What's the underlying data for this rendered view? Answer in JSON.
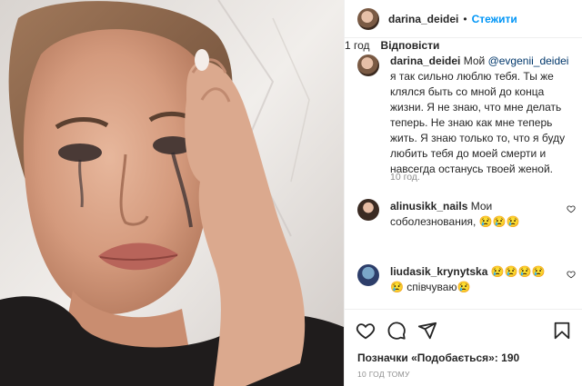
{
  "header": {
    "username": "darina_deidei",
    "separator": "•",
    "follow_label": "Стежити"
  },
  "caption": {
    "username": "darina_deidei",
    "text_before": "Мой ",
    "mention": "@evgenii_deidei",
    "text_after": " я так сильно люблю тебя. Ты же клялся быть со мной до конца жизни. Я не знаю, что мне делать теперь. Не знаю как мне теперь жить. Я знаю только то, что я буду любить тебя до моей смерти и навсегда останусь твоей женой.",
    "time": "10 год."
  },
  "comments": [
    {
      "username": "alinusikk_nails",
      "text": "Мои соболезнования, 😢😢😢",
      "time": "1 год",
      "reply_label": "Відповісти"
    },
    {
      "username": "liudasik_krynytska",
      "text": "😢😢😢😢😢 співчуваю😢",
      "time": "",
      "reply_label": ""
    }
  ],
  "footer": {
    "likes_label": "Позначки «Подобається»: ",
    "likes_count": "190",
    "posted_ago": "10 ГОД ТОМУ"
  },
  "icons": {
    "heart": "heart-icon",
    "comment": "comment-icon",
    "share": "share-icon",
    "save": "bookmark-icon"
  },
  "colors": {
    "accent": "#0095f6",
    "mention": "#00376b",
    "muted": "#8e8e8e",
    "text": "#262626"
  }
}
